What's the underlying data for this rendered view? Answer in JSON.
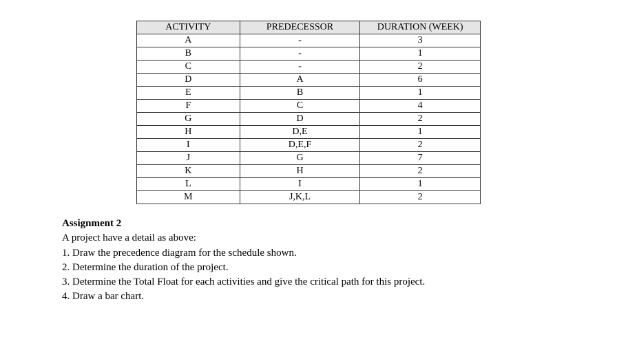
{
  "chart_data": {
    "type": "table",
    "columns": [
      "ACTIVITY",
      "PREDECESSOR",
      "DURATION (WEEK)"
    ],
    "rows": [
      {
        "activity": "A",
        "predecessor": "-",
        "duration": "3"
      },
      {
        "activity": "B",
        "predecessor": "-",
        "duration": "1"
      },
      {
        "activity": "C",
        "predecessor": "-",
        "duration": "2"
      },
      {
        "activity": "D",
        "predecessor": "A",
        "duration": "6"
      },
      {
        "activity": "E",
        "predecessor": "B",
        "duration": "1"
      },
      {
        "activity": "F",
        "predecessor": "C",
        "duration": "4"
      },
      {
        "activity": "G",
        "predecessor": "D",
        "duration": "2"
      },
      {
        "activity": "H",
        "predecessor": "D,E",
        "duration": "1"
      },
      {
        "activity": "I",
        "predecessor": "D,E,F",
        "duration": "2"
      },
      {
        "activity": "J",
        "predecessor": "G",
        "duration": "7"
      },
      {
        "activity": "K",
        "predecessor": "H",
        "duration": "2"
      },
      {
        "activity": "L",
        "predecessor": "I",
        "duration": "1"
      },
      {
        "activity": "M",
        "predecessor": "J,K,L",
        "duration": "2"
      }
    ]
  },
  "assignment": {
    "title": "Assignment 2",
    "intro": "A project have a detail as above:",
    "items": [
      "1. Draw the precedence diagram for the schedule shown.",
      "2. Determine the duration of the project.",
      "3. Determine the Total Float for each activities and give the critical path for this project.",
      "4. Draw a bar chart."
    ]
  }
}
